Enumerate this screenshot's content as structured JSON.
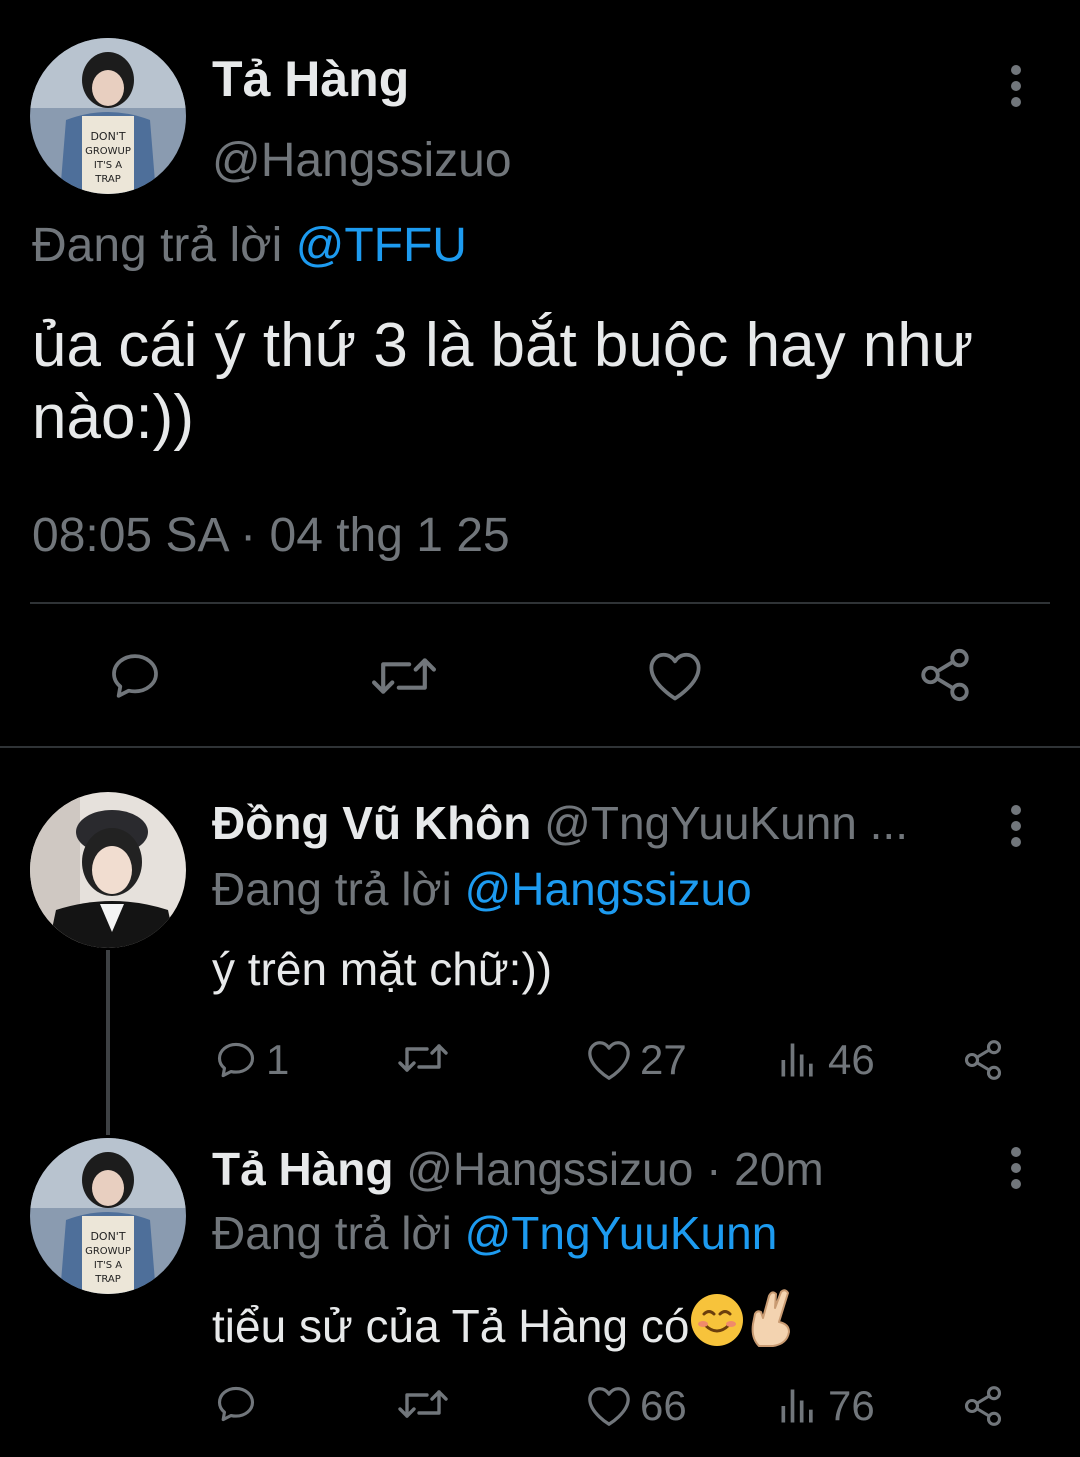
{
  "main_tweet": {
    "name": "Tả Hàng",
    "handle": "@Hangssizuo",
    "reply_prefix": "Đang trả lời",
    "reply_to": "@TFFU",
    "text": "ủa cái ý thứ 3 là bắt buộc hay như nào:))",
    "timestamp": "08:05 SA · 04 thg 1 25",
    "avatar_caption": "DON'T GROW UP. IT'S A TRAP."
  },
  "replies": [
    {
      "name": "Đồng Vũ Khôn",
      "handle": "@TngYuuKunn ...",
      "reply_prefix": "Đang trả lời",
      "reply_to": "@Hangssizuo",
      "text": "ý trên mặt chữ:))",
      "replies_count": "1",
      "retweets_count": "",
      "likes_count": "27",
      "views_count": "46"
    },
    {
      "name": "Tả Hàng",
      "handle": "@Hangssizuo · 20m",
      "reply_prefix": "Đang trả lời",
      "reply_to": "@TngYuuKunn",
      "text": "tiểu sử của Tả Hàng có",
      "emoji_1": "smiling-face-icon",
      "emoji_2": "crossed-fingers-icon",
      "replies_count": "",
      "retweets_count": "",
      "likes_count": "66",
      "views_count": "76"
    }
  ],
  "colors": {
    "background": "#000000",
    "text": "#e7e9ea",
    "muted": "#71767b",
    "accent": "#1d9bf0",
    "divider": "#2f3336"
  }
}
